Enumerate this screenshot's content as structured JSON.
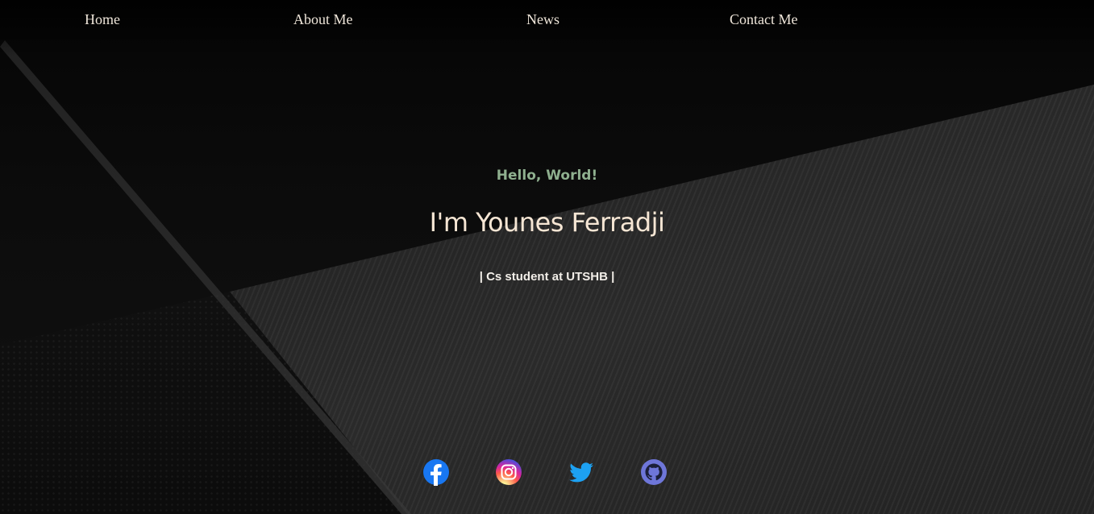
{
  "nav": {
    "items": [
      {
        "label": "Home"
      },
      {
        "label": "About Me"
      },
      {
        "label": "News"
      },
      {
        "label": "Contact Me"
      }
    ]
  },
  "hero": {
    "greeting": "Hello, World!",
    "name": "I'm Younes Ferradji",
    "tagline": "| Cs student at UTSHB |"
  },
  "socials": [
    {
      "icon": "facebook-icon",
      "color": "#1877f2"
    },
    {
      "icon": "instagram-icon",
      "color": "#d6249f"
    },
    {
      "icon": "twitter-icon",
      "color": "#1da1f2"
    },
    {
      "icon": "github-icon",
      "color": "#6e76d9"
    }
  ],
  "colors": {
    "greeting": "#8fb08f",
    "name": "#f6e6d4",
    "nav_text": "#efe6da",
    "background": "#0b0b0b"
  }
}
